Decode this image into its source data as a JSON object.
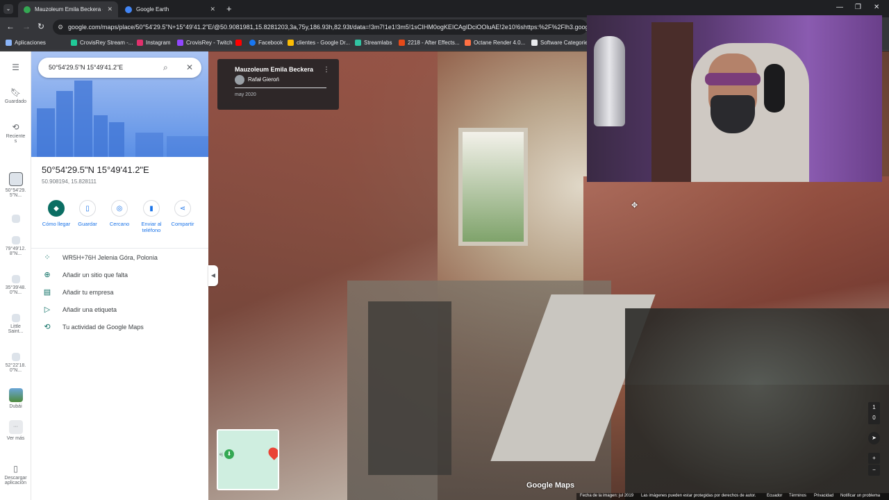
{
  "browser": {
    "tabs": [
      {
        "title": "Mauzoleum Emila Beckera - Go",
        "favicon_color": "#34a853"
      },
      {
        "title": "Google Earth",
        "favicon_color": "#4285f4"
      }
    ],
    "url": "google.com/maps/place/50°54'29.5\"N+15°49'41.2\"E/@50.9081981,15.8281203,3a,75y,186.93h,82.93t/data=!3m7!1e1!3m5!1sCIHM0ogKEICAgIDciOOluAE!2e10!6shttps:%2F%2Flh3.googleusercon",
    "bookmarks": [
      {
        "label": "Aplicaciones",
        "color": "#8ab4f8"
      },
      {
        "label": "CrovisRey Stream -...",
        "color": "#20c997"
      },
      {
        "label": "Instagram",
        "color": "#e1306c"
      },
      {
        "label": "CrovisRey - Twitch",
        "color": "#9146ff"
      },
      {
        "label": "",
        "color": "#ff0000"
      },
      {
        "label": "Facebook",
        "color": "#1877f2"
      },
      {
        "label": "clientes - Google Dr...",
        "color": "#fbbc04"
      },
      {
        "label": "Streamlabs",
        "color": "#31c3a2"
      },
      {
        "label": "2218 - After Effects...",
        "color": "#e64a19"
      },
      {
        "label": "Octane Render 4.0...",
        "color": "#ff7043"
      },
      {
        "label": "Software Categorie",
        "color": "#e8eaed"
      }
    ]
  },
  "rail": {
    "items": [
      {
        "label": "Guardado",
        "icon": "bookmark-icon"
      },
      {
        "label": "Reciente\ns",
        "icon": "history-icon"
      },
      {
        "label": "50°54'29.\n5\"N..."
      },
      {
        "label": ""
      },
      {
        "label": "79°49'12.\n8\"N..."
      },
      {
        "label": "35°39'48.\n0\"N..."
      },
      {
        "label": "Little\nSaint..."
      },
      {
        "label": "52°22'18.\n0\"N..."
      },
      {
        "label": "Dubái"
      },
      {
        "label": "Ver más"
      },
      {
        "label": "Descargar\naplicación"
      }
    ]
  },
  "panel": {
    "search_value": "50°54'29.5\"N 15°49'41.2\"E",
    "title": "50°54'29.5\"N 15°49'41.2\"E",
    "decimal": "50.908194, 15.828111",
    "actions": [
      {
        "label": "Cómo llegar",
        "icon": "directions-icon"
      },
      {
        "label": "Guardar",
        "icon": "bookmark-icon"
      },
      {
        "label": "Cercano",
        "icon": "nearby-icon"
      },
      {
        "label": "Enviar al teléfono",
        "icon": "send-to-phone-icon"
      },
      {
        "label": "Compartir",
        "icon": "share-icon"
      }
    ],
    "info": [
      {
        "text": "WR5H+76H Jelenia Góra, Polonia",
        "icon": "plus-code-icon"
      },
      {
        "text": "Añadir un sitio que falta",
        "icon": "add-place-icon"
      },
      {
        "text": "Añadir tu empresa",
        "icon": "business-icon"
      },
      {
        "text": "Añadir una etiqueta",
        "icon": "label-icon"
      },
      {
        "text": "Tu actividad de Google Maps",
        "icon": "activity-icon"
      }
    ]
  },
  "streetview": {
    "place_name": "Mauzoleum Emila Beckera",
    "author": "Rafał Gieroń",
    "date": "may 2020",
    "logo": "Google Maps",
    "footer": {
      "image_date": "Fecha de la imagen: jul 2019",
      "copyright": "Las imágenes pueden estar protegidas por derechos de autor.",
      "country": "Ecuador",
      "terms": "Términos",
      "privacy": "Privacidad",
      "report": "Notificar un problema"
    },
    "minimap_label": "ej",
    "ctrl_1": "1",
    "ctrl_0": "0"
  }
}
